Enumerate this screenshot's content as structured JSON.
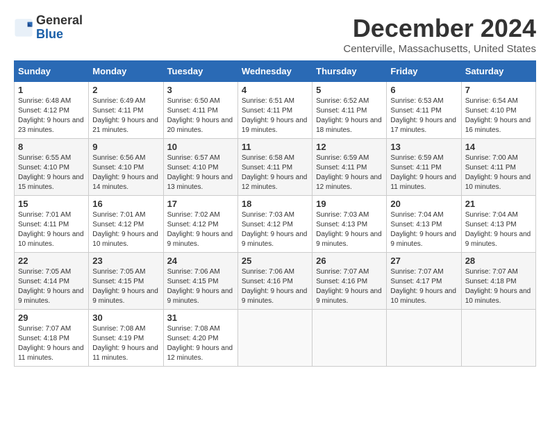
{
  "logo": {
    "general": "General",
    "blue": "Blue"
  },
  "title": "December 2024",
  "location": "Centerville, Massachusetts, United States",
  "headers": [
    "Sunday",
    "Monday",
    "Tuesday",
    "Wednesday",
    "Thursday",
    "Friday",
    "Saturday"
  ],
  "weeks": [
    [
      {
        "day": "1",
        "sunrise": "6:48 AM",
        "sunset": "4:12 PM",
        "daylight": "9 hours and 23 minutes."
      },
      {
        "day": "2",
        "sunrise": "6:49 AM",
        "sunset": "4:11 PM",
        "daylight": "9 hours and 21 minutes."
      },
      {
        "day": "3",
        "sunrise": "6:50 AM",
        "sunset": "4:11 PM",
        "daylight": "9 hours and 20 minutes."
      },
      {
        "day": "4",
        "sunrise": "6:51 AM",
        "sunset": "4:11 PM",
        "daylight": "9 hours and 19 minutes."
      },
      {
        "day": "5",
        "sunrise": "6:52 AM",
        "sunset": "4:11 PM",
        "daylight": "9 hours and 18 minutes."
      },
      {
        "day": "6",
        "sunrise": "6:53 AM",
        "sunset": "4:11 PM",
        "daylight": "9 hours and 17 minutes."
      },
      {
        "day": "7",
        "sunrise": "6:54 AM",
        "sunset": "4:10 PM",
        "daylight": "9 hours and 16 minutes."
      }
    ],
    [
      {
        "day": "8",
        "sunrise": "6:55 AM",
        "sunset": "4:10 PM",
        "daylight": "9 hours and 15 minutes."
      },
      {
        "day": "9",
        "sunrise": "6:56 AM",
        "sunset": "4:10 PM",
        "daylight": "9 hours and 14 minutes."
      },
      {
        "day": "10",
        "sunrise": "6:57 AM",
        "sunset": "4:10 PM",
        "daylight": "9 hours and 13 minutes."
      },
      {
        "day": "11",
        "sunrise": "6:58 AM",
        "sunset": "4:11 PM",
        "daylight": "9 hours and 12 minutes."
      },
      {
        "day": "12",
        "sunrise": "6:59 AM",
        "sunset": "4:11 PM",
        "daylight": "9 hours and 12 minutes."
      },
      {
        "day": "13",
        "sunrise": "6:59 AM",
        "sunset": "4:11 PM",
        "daylight": "9 hours and 11 minutes."
      },
      {
        "day": "14",
        "sunrise": "7:00 AM",
        "sunset": "4:11 PM",
        "daylight": "9 hours and 10 minutes."
      }
    ],
    [
      {
        "day": "15",
        "sunrise": "7:01 AM",
        "sunset": "4:11 PM",
        "daylight": "9 hours and 10 minutes."
      },
      {
        "day": "16",
        "sunrise": "7:01 AM",
        "sunset": "4:12 PM",
        "daylight": "9 hours and 10 minutes."
      },
      {
        "day": "17",
        "sunrise": "7:02 AM",
        "sunset": "4:12 PM",
        "daylight": "9 hours and 9 minutes."
      },
      {
        "day": "18",
        "sunrise": "7:03 AM",
        "sunset": "4:12 PM",
        "daylight": "9 hours and 9 minutes."
      },
      {
        "day": "19",
        "sunrise": "7:03 AM",
        "sunset": "4:13 PM",
        "daylight": "9 hours and 9 minutes."
      },
      {
        "day": "20",
        "sunrise": "7:04 AM",
        "sunset": "4:13 PM",
        "daylight": "9 hours and 9 minutes."
      },
      {
        "day": "21",
        "sunrise": "7:04 AM",
        "sunset": "4:13 PM",
        "daylight": "9 hours and 9 minutes."
      }
    ],
    [
      {
        "day": "22",
        "sunrise": "7:05 AM",
        "sunset": "4:14 PM",
        "daylight": "9 hours and 9 minutes."
      },
      {
        "day": "23",
        "sunrise": "7:05 AM",
        "sunset": "4:15 PM",
        "daylight": "9 hours and 9 minutes."
      },
      {
        "day": "24",
        "sunrise": "7:06 AM",
        "sunset": "4:15 PM",
        "daylight": "9 hours and 9 minutes."
      },
      {
        "day": "25",
        "sunrise": "7:06 AM",
        "sunset": "4:16 PM",
        "daylight": "9 hours and 9 minutes."
      },
      {
        "day": "26",
        "sunrise": "7:07 AM",
        "sunset": "4:16 PM",
        "daylight": "9 hours and 9 minutes."
      },
      {
        "day": "27",
        "sunrise": "7:07 AM",
        "sunset": "4:17 PM",
        "daylight": "9 hours and 10 minutes."
      },
      {
        "day": "28",
        "sunrise": "7:07 AM",
        "sunset": "4:18 PM",
        "daylight": "9 hours and 10 minutes."
      }
    ],
    [
      {
        "day": "29",
        "sunrise": "7:07 AM",
        "sunset": "4:18 PM",
        "daylight": "9 hours and 11 minutes."
      },
      {
        "day": "30",
        "sunrise": "7:08 AM",
        "sunset": "4:19 PM",
        "daylight": "9 hours and 11 minutes."
      },
      {
        "day": "31",
        "sunrise": "7:08 AM",
        "sunset": "4:20 PM",
        "daylight": "9 hours and 12 minutes."
      },
      null,
      null,
      null,
      null
    ]
  ]
}
